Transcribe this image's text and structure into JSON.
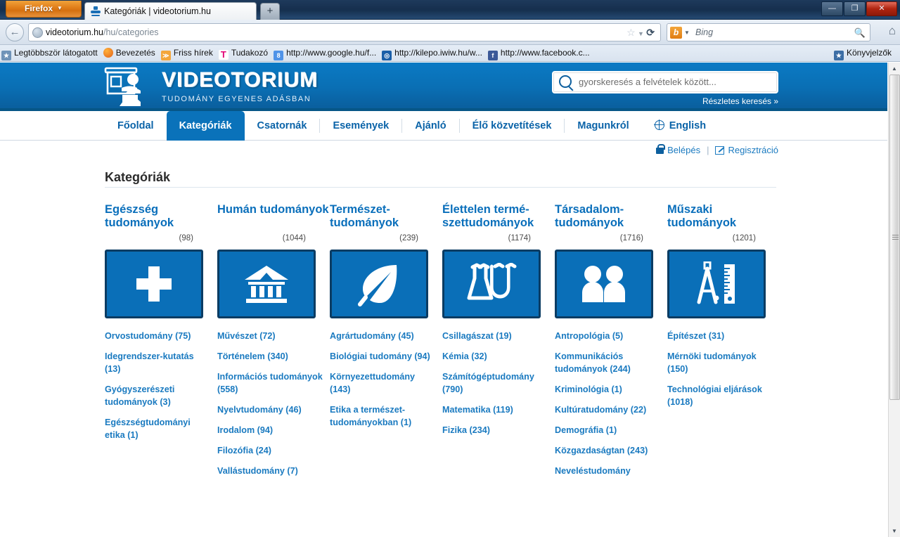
{
  "browser": {
    "firefox_button": "Firefox",
    "tab_title": "Kategóriák | videotorium.hu",
    "new_tab_label": "+",
    "window_controls": {
      "minimize": "—",
      "maximize": "❐",
      "close": "✕"
    },
    "url_domain": "videotorium.hu",
    "url_path": "/hu/categories",
    "search_engine": "Bing",
    "bookmarks": [
      {
        "label": "Legtöbbször látogatott",
        "icon": "most-visited-icon"
      },
      {
        "label": "Bevezetés",
        "icon": "firefox-icon"
      },
      {
        "label": "Friss hírek",
        "icon": "rss-icon"
      },
      {
        "label": "Tudakozó",
        "icon": "telekom-icon"
      },
      {
        "label": "http://www.google.hu/f...",
        "icon": "google-icon"
      },
      {
        "label": "http://kilepo.iwiw.hu/w...",
        "icon": "iwiw-icon"
      },
      {
        "label": "http://www.facebook.c...",
        "icon": "facebook-icon"
      }
    ],
    "bookmarks_menu": "Könyvjelzők"
  },
  "site": {
    "brand": "VIDEOTORIUM",
    "tagline": "TUDOMÁNY EGYENES ADÁSBAN",
    "search_placeholder": "gyorskeresés a felvételek között...",
    "advanced_search": "Részletes keresés »",
    "nav": [
      {
        "label": "Főoldal",
        "active": false,
        "icon": null
      },
      {
        "label": "Kategóriák",
        "active": true,
        "icon": null
      },
      {
        "label": "Csatornák",
        "active": false,
        "icon": null
      },
      {
        "label": "Események",
        "active": false,
        "icon": null
      },
      {
        "label": "Ajánló",
        "active": false,
        "icon": null
      },
      {
        "label": "Élő közvetítések",
        "active": false,
        "icon": null
      },
      {
        "label": "Magunkról",
        "active": false,
        "icon": null
      },
      {
        "label": "English",
        "active": false,
        "icon": "globe-icon"
      }
    ],
    "user": {
      "login": "Belépés",
      "register": "Regisztráció",
      "separator": "|"
    }
  },
  "main": {
    "page_title": "Kategóriák",
    "columns": [
      {
        "title": "Egészség tudományok",
        "count": "(98)",
        "icon": "plus-cross-icon",
        "links": [
          "Orvostudomány (75)",
          "Idegrendszer-kutatás (13)",
          "Gyógyszerészeti tudományok (3)",
          "Egészségtudományi etika (1)"
        ]
      },
      {
        "title": "Humán tudományok",
        "count": "(1044)",
        "icon": "classical-building-icon",
        "links": [
          "Művészet (72)",
          "Történelem (340)",
          "Információs tudományok (558)",
          "Nyelvtudomány (46)",
          "Irodalom (94)",
          "Filozófia (24)",
          "Vallástudomány (7)"
        ]
      },
      {
        "title": "Természet-tudományok",
        "count": "(239)",
        "icon": "leaf-icon",
        "links": [
          "Agrártudomány (45)",
          "Biológiai tudomány (94)",
          "Környezettudomány (143)",
          "Etika a természet-tudományokban (1)"
        ]
      },
      {
        "title": "Élettelen termé-szettudományok",
        "count": "(1174)",
        "icon": "flask-test-tube-icon",
        "links": [
          "Csillagászat (19)",
          "Kémia (32)",
          "Számítógéptudomány (790)",
          "Matematika (119)",
          "Fizika (234)"
        ]
      },
      {
        "title": "Társadalom-tudományok",
        "count": "(1716)",
        "icon": "two-people-icon",
        "links": [
          "Antropológia (5)",
          "Kommunikációs tudományok (244)",
          "Kriminológia (1)",
          "Kultúratudomány (22)",
          "Demográfia (1)",
          "Közgazdaságtan (243)",
          "Neveléstudomány"
        ]
      },
      {
        "title": "Műszaki tudományok",
        "count": "(1201)",
        "icon": "compass-ruler-icon",
        "links": [
          "Építészet (31)",
          "Mérnöki tudományok (150)",
          "Technológiai eljárások (1018)"
        ]
      }
    ]
  },
  "colors": {
    "brand_blue": "#0a6fb8",
    "header_blue": "#0b7ac4",
    "link_blue": "#1a7ac0",
    "tile_border": "#0b3c63",
    "nav_active_bg": "#0a72ba"
  }
}
